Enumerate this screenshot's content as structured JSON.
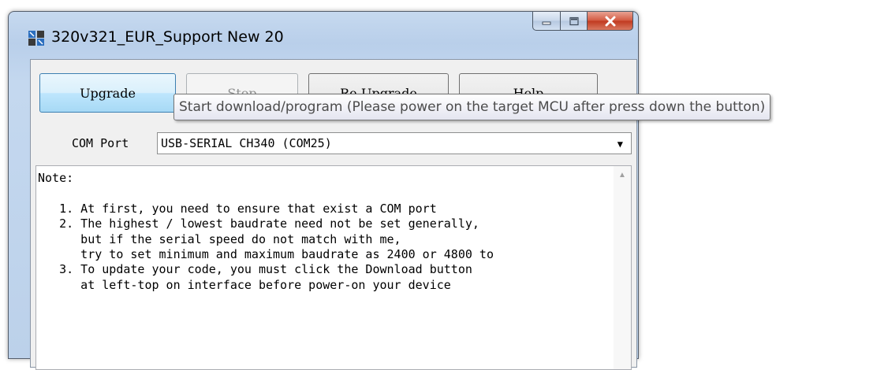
{
  "window": {
    "title": "320v321_EUR_Support New 20",
    "caption_buttons": {
      "minimize": "minimize-icon",
      "maximize": "maximize-icon",
      "close": "close-icon"
    }
  },
  "toolbar": {
    "upgrade_label": "Upgrade",
    "stop_label": "Stop",
    "reupgrade_label": "Re-Upgrade",
    "help_label": "Help"
  },
  "com_port": {
    "label": "COM Port",
    "selected": "USB-SERIAL CH340 (COM25)"
  },
  "note": {
    "text": "Note:\n\n   1. At first, you need to ensure that exist a COM port\n   2. The highest / lowest baudrate need not be set generally,\n      but if the serial speed do not match with me,\n      try to set minimum and maximum baudrate as 2400 or 4800 to\n   3. To update your code, you must click the Download button\n      at left-top on interface before power-on your device"
  },
  "tooltip": {
    "text": "Start download/program (Please power on the target MCU after press down the button)"
  },
  "colors": {
    "active_button": "#bee6fd",
    "close_button": "#c0391f",
    "frame": "#b9cfea"
  }
}
